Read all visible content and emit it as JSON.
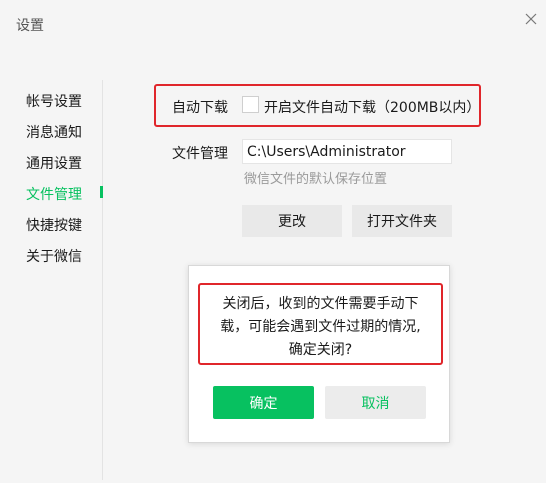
{
  "window": {
    "title": "设置"
  },
  "sidebar": {
    "items": [
      {
        "label": "帐号设置"
      },
      {
        "label": "消息通知"
      },
      {
        "label": "通用设置"
      },
      {
        "label": "文件管理",
        "active": true
      },
      {
        "label": "快捷按键"
      },
      {
        "label": "关于微信"
      }
    ]
  },
  "auto_download": {
    "label": "自动下载",
    "checkbox_label": "开启文件自动下载（200MB以内）",
    "checked": false
  },
  "file_management": {
    "label": "文件管理",
    "path_value": "C:\\Users\\Administrator",
    "hint": "微信文件的默认保存位置",
    "change_button": "更改",
    "open_folder_button": "打开文件夹"
  },
  "dialog": {
    "message_line1": "关闭后，收到的文件需要手动下",
    "message_line2": "载，可能会遇到文件过期的情况,",
    "message_line3": "确定关闭?",
    "confirm_button": "确定",
    "cancel_button": "取消"
  },
  "colors": {
    "accent": "#07c160",
    "highlight": "#e0262b"
  },
  "icons": {
    "close": "close-icon"
  }
}
